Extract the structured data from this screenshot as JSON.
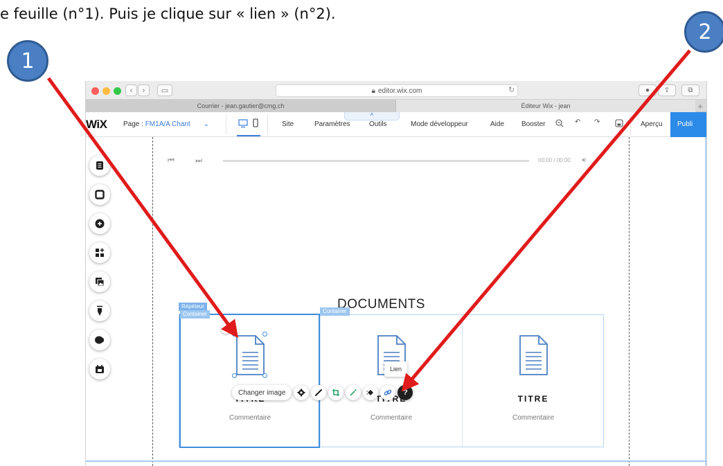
{
  "caption": "e feuille (n°1). Puis je clique sur « lien » (n°2).",
  "badges": [
    "1",
    "2"
  ],
  "browser": {
    "url": "editor.wix.com",
    "tabs": [
      "Courrier - jean.gautier@cmg.ch",
      "Éditeur Wix - jean"
    ],
    "new_tab": "+"
  },
  "wix": {
    "logo": "WiX",
    "page_label": "Page :",
    "page_name": "FM1A/A Chant",
    "menu": [
      "Site",
      "Paramètres",
      "Outils",
      "Mode développeur",
      "Aide",
      "Booster"
    ],
    "preview": "Aperçu",
    "publish": "Publi"
  },
  "player": {
    "time": "00:00 / 00:00"
  },
  "section_title": "DOCUMENTS",
  "tags": {
    "repeater": "Répéteur",
    "container": "Container"
  },
  "cards": [
    {
      "title": "TITRE",
      "comment": "Commentaire"
    },
    {
      "title": "TITRE",
      "comment": "Commentaire"
    },
    {
      "title": "TITRE",
      "comment": "Commentaire"
    }
  ],
  "toolbar": {
    "change_image": "Changer image",
    "tooltip": "Lien"
  },
  "side_tools": [
    "pages-icon",
    "background-icon",
    "add-icon",
    "apps-icon",
    "media-icon",
    "pen-icon",
    "chat-icon",
    "booking-icon"
  ],
  "colors": {
    "wix_blue": "#2c8ae8",
    "arrow_red": "#e01b1b",
    "badge_blue": "#4a7fc4"
  }
}
